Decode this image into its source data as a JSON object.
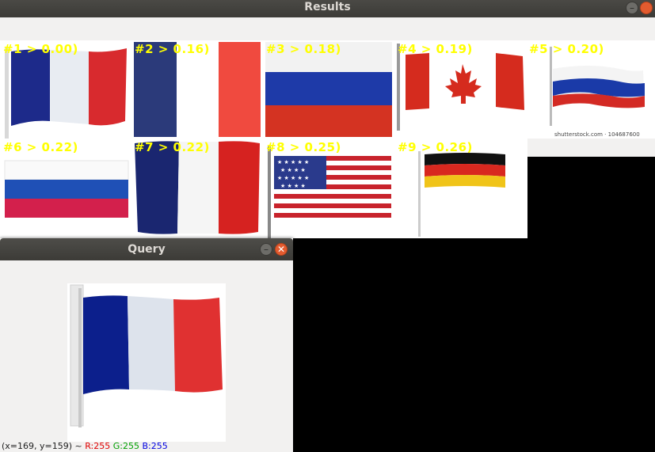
{
  "results_window": {
    "title": "Results",
    "min_label": "–",
    "labels": [
      "#1 > 0.00)",
      "#2 > 0.16)",
      "#3 > 0.18)",
      "#4 > 0.19)",
      "#5 > 0.20)",
      "#6 > 0.22)",
      "#7 > 0.22)",
      "#8 > 0.25)",
      "#9 > 0.26)"
    ],
    "flags": [
      "France",
      "France",
      "Russia",
      "Canada",
      "Russia",
      "Russia",
      "France",
      "United States",
      "Germany"
    ],
    "watermark": "shutterstock.com · 104687600"
  },
  "query_window": {
    "title": "Query",
    "min_label": "–",
    "close_label": "✕",
    "status": {
      "coords": "(x=169, y=159) ~ ",
      "r": "R:255",
      "g": "G:255",
      "b": "B:255"
    }
  },
  "label_color": "#ffff00",
  "close_color": "#e35b2f"
}
